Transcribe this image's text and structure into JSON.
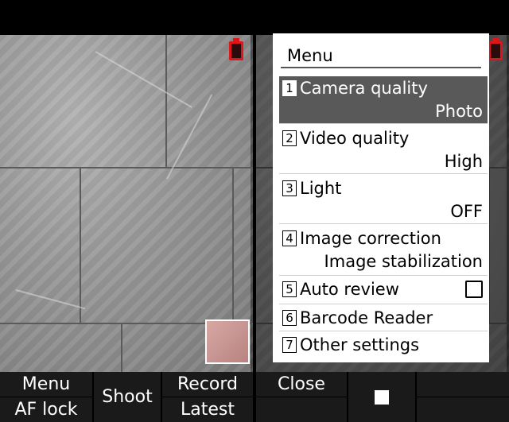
{
  "left": {
    "softkeys": {
      "top_left": "Menu",
      "bottom_left": "AF lock",
      "center": "Shoot",
      "top_right": "Record",
      "bottom_right": "Latest"
    }
  },
  "right": {
    "menu": {
      "title": "Menu",
      "items": [
        {
          "num": "1",
          "label": "Camera quality",
          "value": "Photo"
        },
        {
          "num": "2",
          "label": "Video quality",
          "value": "High"
        },
        {
          "num": "3",
          "label": "Light",
          "value": "OFF"
        },
        {
          "num": "4",
          "label": "Image correction",
          "value": "Image stabilization"
        },
        {
          "num": "5",
          "label": "Auto review"
        },
        {
          "num": "6",
          "label": "Barcode Reader"
        },
        {
          "num": "7",
          "label": "Other settings"
        }
      ]
    },
    "softkeys": {
      "left": "Close",
      "center_icon": "stop-icon"
    }
  },
  "colors": {
    "battery": "#e0151a",
    "selected_item_bg": "#595959",
    "softkey_bg": "#1a1a1a"
  }
}
